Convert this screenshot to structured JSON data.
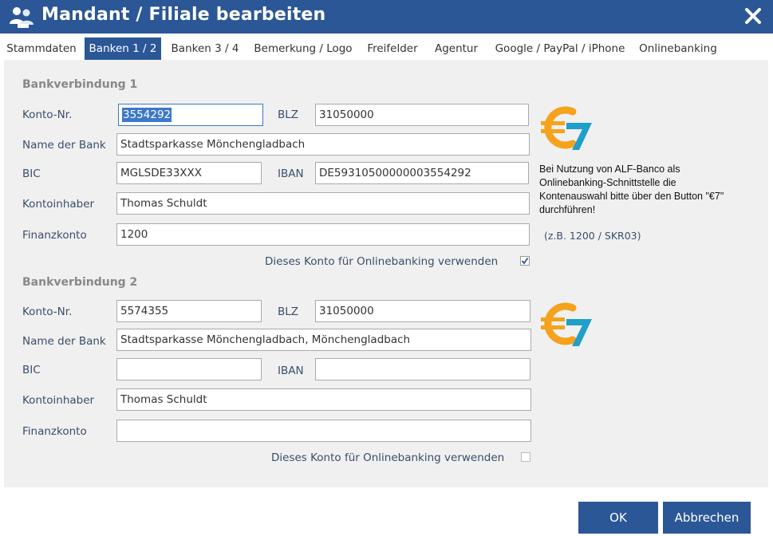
{
  "window": {
    "title": "Mandant / Filiale bearbeiten",
    "icon": "users-icon",
    "close_icon": "close-icon"
  },
  "tabs": [
    {
      "label": "Stammdaten",
      "active": false
    },
    {
      "label": "Banken 1 / 2",
      "active": true
    },
    {
      "label": "Banken 3 / 4",
      "active": false
    },
    {
      "label": "Bemerkung / Logo",
      "active": false
    },
    {
      "label": "Freifelder",
      "active": false
    },
    {
      "label": "Agentur",
      "active": false
    },
    {
      "label": "Google / PayPal / iPhone",
      "active": false
    },
    {
      "label": "Onlinebanking",
      "active": false
    }
  ],
  "labels": {
    "konto_nr": "Konto-Nr.",
    "blz": "BLZ",
    "name_der_bank": "Name der Bank",
    "bic": "BIC",
    "iban": "IBAN",
    "kontoinhaber": "Kontoinhaber",
    "finanzkonto": "Finanzkonto",
    "onlinebanking": "Dieses Konto für Onlinebanking verwenden"
  },
  "bank1": {
    "title": "Bankverbindung 1",
    "konto_nr": "3554292",
    "blz": "31050000",
    "name_der_bank": "Stadtsparkasse Mönchengladbach",
    "bic": "MGLSDE33XXX",
    "iban": "DE59310500000003554292",
    "kontoinhaber": "Thomas Schuldt",
    "finanzkonto": "1200",
    "onlinebanking_checked": true
  },
  "bank2": {
    "title": "Bankverbindung 2",
    "konto_nr": "5574355",
    "blz": "31050000",
    "name_der_bank": "Stadtsparkasse Mönchengladbach, Mönchengladbach",
    "bic": "",
    "iban": "",
    "kontoinhaber": "Thomas Schuldt",
    "finanzkonto": "",
    "onlinebanking_checked": false
  },
  "note": "Bei Nutzung von ALF-Banco als Onlinebanking-Schnittstelle die Kontenauswahl bitte über den Button \"€7\" durchführen!",
  "finanzkonto_hint": "(z.B. 1200 / SKR03)",
  "buttons": {
    "ok": "OK",
    "cancel": "Abbrechen"
  },
  "colors": {
    "accent": "#2b5797",
    "panel": "#f0f0f0",
    "logo_orange": "#f5a21c",
    "logo_teal": "#1f9fc9"
  }
}
